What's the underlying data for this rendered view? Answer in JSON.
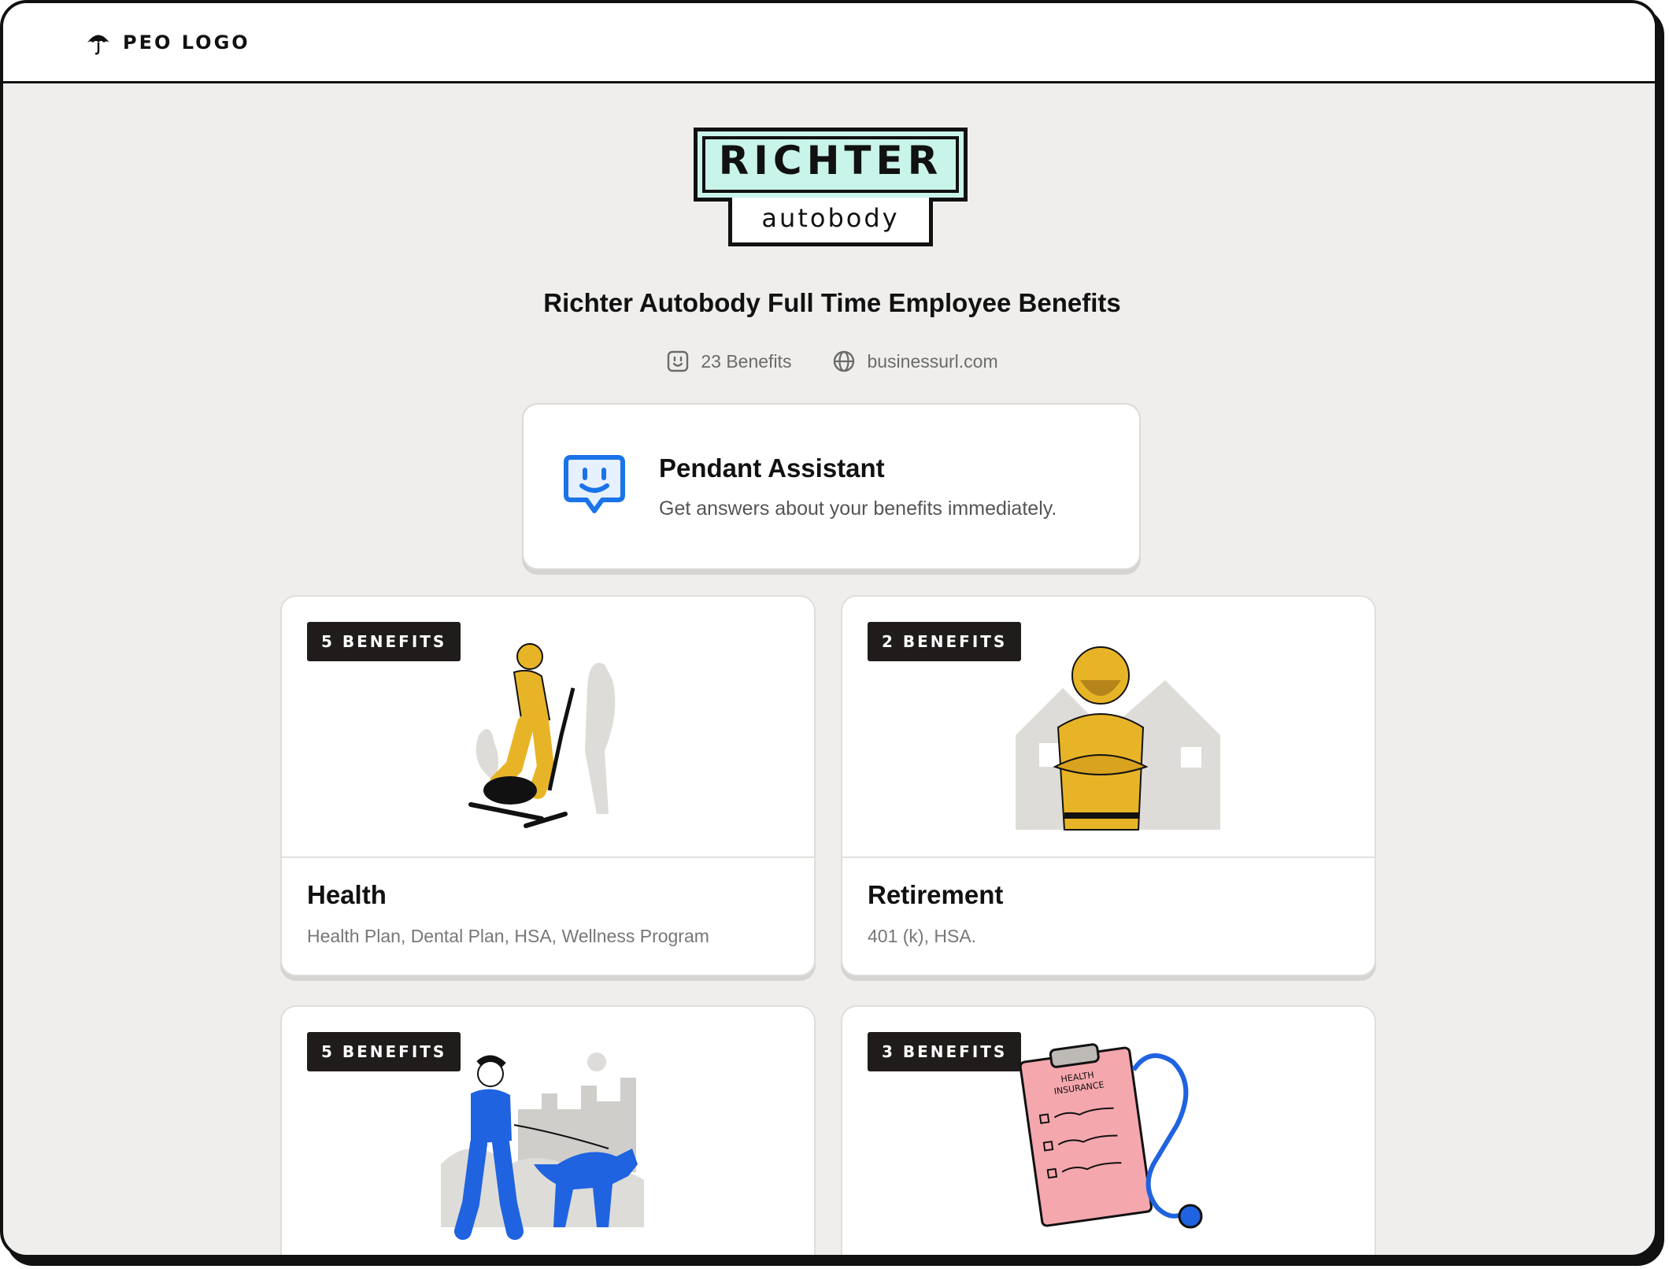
{
  "header": {
    "logo_text": "PEO LOGO"
  },
  "brand": {
    "name": "RICHTER",
    "sub": "autobody"
  },
  "page": {
    "title": "Richter Autobody Full Time Employee Benefits",
    "benefits_count": "23 Benefits",
    "website": "businessurl.com"
  },
  "assistant": {
    "title": "Pendant Assistant",
    "description": "Get answers about your benefits immediately."
  },
  "cards": [
    {
      "badge": "5 BENEFITS",
      "title": "Health",
      "items": "Health Plan, Dental Plan, HSA, Wellness Program"
    },
    {
      "badge": "2 BENEFITS",
      "title": "Retirement",
      "items": "401 (k), HSA."
    },
    {
      "badge": "5 BENEFITS",
      "title": "",
      "items": ""
    },
    {
      "badge": "3 BENEFITS",
      "title": "",
      "items": ""
    }
  ],
  "clipboard_text": [
    "HEALTH",
    "INSURANCE"
  ]
}
